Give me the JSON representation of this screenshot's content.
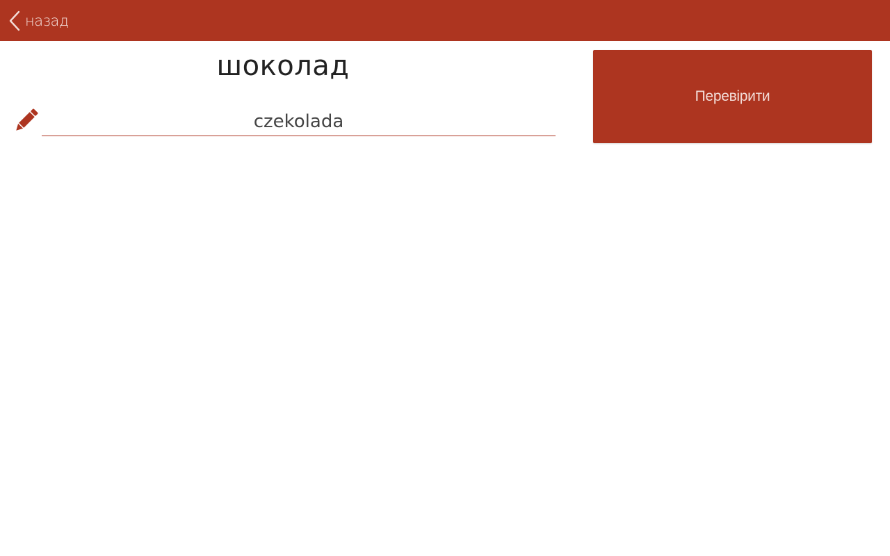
{
  "header": {
    "back_label": "назад",
    "back_icon": "chevron-left-icon",
    "background_color": "#ad3520"
  },
  "exercise": {
    "word": "шоколад",
    "answer_value": "czekolada",
    "answer_icon": "pencil-icon"
  },
  "actions": {
    "check_label": "Перевірити"
  },
  "colors": {
    "accent": "#ad3520",
    "text_light": "#f3ddd8",
    "text_dark": "#222222"
  }
}
